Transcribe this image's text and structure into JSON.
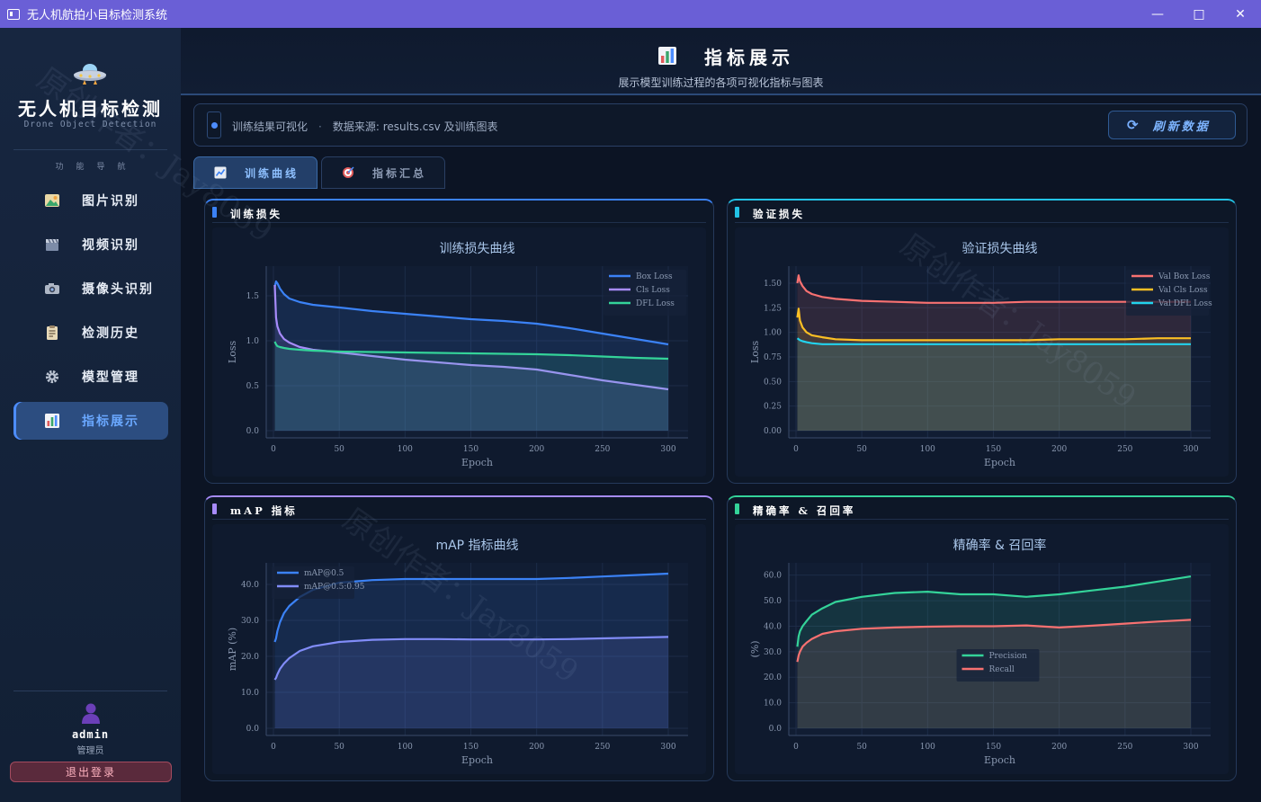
{
  "window": {
    "title": "无人机航拍小目标检测系统",
    "controls": [
      "minimize-icon",
      "maximize-icon",
      "close-icon"
    ]
  },
  "sidebar": {
    "brand_title": "无人机目标检测",
    "brand_subtitle": "Drone Object Detection",
    "nav_header": "功能导航",
    "items": [
      {
        "label": "图片识别",
        "icon": "image-icon"
      },
      {
        "label": "视频识别",
        "icon": "clapperboard-icon"
      },
      {
        "label": "摄像头识别",
        "icon": "camera-icon"
      },
      {
        "label": "检测历史",
        "icon": "clipboard-icon"
      },
      {
        "label": "模型管理",
        "icon": "gear-icon"
      },
      {
        "label": "指标展示",
        "icon": "bar-chart-icon",
        "active": true
      }
    ],
    "user": {
      "name": "admin",
      "role": "管理员"
    },
    "logout_label": "退出登录"
  },
  "header": {
    "title": "指标展示",
    "subtitle": "展示模型训练过程的各项可视化指标与图表"
  },
  "info_bar": {
    "label": "训练结果可视化",
    "separator": "·",
    "source": "数据来源: results.csv 及训练图表"
  },
  "refresh_label": "刷新数据",
  "tabs": [
    {
      "label": "训练曲线",
      "active": true
    },
    {
      "label": "指标汇总",
      "active": false
    }
  ],
  "panels": [
    {
      "title": "训练损失",
      "accent": "#3b82f6"
    },
    {
      "title": "验证损失",
      "accent": "#22c3e6"
    },
    {
      "title": "mAP 指标",
      "accent": "#a78bfa"
    },
    {
      "title": "精确率 & 召回率",
      "accent": "#34d399"
    }
  ],
  "watermark": "原创作者：Jay8059",
  "colors": {
    "titlebar": "#6a5fd6",
    "accent": "#4d8dff",
    "panel_bg": "#0f1a2e"
  },
  "chart_data": [
    {
      "type": "line",
      "title": "训练损失曲线",
      "xlabel": "Epoch",
      "ylabel": "Loss",
      "xlim": [
        0,
        300
      ],
      "ylim": [
        0,
        1.75
      ],
      "xticks": [
        0,
        50,
        100,
        150,
        200,
        250,
        300
      ],
      "yticks": [
        0,
        0.5,
        1.0,
        1.5
      ],
      "ytick_labels": [
        "0.0",
        "0.5",
        "1.0",
        "1.5"
      ],
      "legend": "top-right",
      "grid": true,
      "x": [
        1,
        2,
        3,
        5,
        8,
        12,
        20,
        30,
        50,
        75,
        100,
        125,
        150,
        175,
        200,
        225,
        250,
        275,
        300
      ],
      "series": [
        {
          "name": "Box Loss",
          "color": "#3b82f6",
          "values": [
            1.6,
            1.66,
            1.64,
            1.58,
            1.52,
            1.47,
            1.43,
            1.4,
            1.37,
            1.33,
            1.3,
            1.27,
            1.24,
            1.22,
            1.19,
            1.14,
            1.08,
            1.02,
            0.96
          ]
        },
        {
          "name": "Cls Loss",
          "color": "#a78bfa",
          "values": [
            1.62,
            1.26,
            1.16,
            1.08,
            1.02,
            0.98,
            0.93,
            0.9,
            0.87,
            0.83,
            0.79,
            0.76,
            0.73,
            0.71,
            0.68,
            0.62,
            0.56,
            0.51,
            0.46
          ]
        },
        {
          "name": "DFL Loss",
          "color": "#34d399",
          "values": [
            0.99,
            0.96,
            0.94,
            0.93,
            0.92,
            0.91,
            0.9,
            0.89,
            0.88,
            0.875,
            0.87,
            0.865,
            0.86,
            0.855,
            0.85,
            0.84,
            0.825,
            0.81,
            0.8
          ]
        }
      ]
    },
    {
      "type": "line",
      "title": "验证损失曲线",
      "xlabel": "Epoch",
      "ylabel": "Loss",
      "xlim": [
        0,
        300
      ],
      "ylim": [
        0,
        1.6
      ],
      "xticks": [
        0,
        50,
        100,
        150,
        200,
        250,
        300
      ],
      "yticks": [
        0,
        0.25,
        0.5,
        0.75,
        1.0,
        1.25,
        1.5
      ],
      "ytick_labels": [
        "0.00",
        "0.25",
        "0.50",
        "0.75",
        "1.00",
        "1.25",
        "1.50"
      ],
      "legend": "top-right",
      "grid": true,
      "x": [
        1,
        2,
        3,
        5,
        8,
        12,
        20,
        30,
        50,
        75,
        100,
        125,
        150,
        175,
        200,
        225,
        250,
        275,
        300
      ],
      "series": [
        {
          "name": "Val Box Loss",
          "color": "#f87171",
          "values": [
            1.5,
            1.58,
            1.52,
            1.47,
            1.42,
            1.39,
            1.36,
            1.34,
            1.32,
            1.31,
            1.3,
            1.3,
            1.3,
            1.31,
            1.31,
            1.31,
            1.31,
            1.31,
            1.31
          ]
        },
        {
          "name": "Val Cls Loss",
          "color": "#fbbf24",
          "values": [
            1.15,
            1.24,
            1.12,
            1.05,
            1.0,
            0.97,
            0.95,
            0.93,
            0.92,
            0.92,
            0.92,
            0.92,
            0.92,
            0.92,
            0.93,
            0.93,
            0.93,
            0.94,
            0.94
          ]
        },
        {
          "name": "Val DFL Loss",
          "color": "#22d3ee",
          "values": [
            0.94,
            0.93,
            0.92,
            0.91,
            0.9,
            0.89,
            0.88,
            0.88,
            0.88,
            0.88,
            0.88,
            0.88,
            0.88,
            0.88,
            0.88,
            0.88,
            0.88,
            0.88,
            0.88
          ]
        }
      ]
    },
    {
      "type": "line",
      "title": "mAP 指标曲线",
      "xlabel": "Epoch",
      "ylabel": "mAP (%)",
      "xlim": [
        0,
        300
      ],
      "ylim": [
        0,
        44
      ],
      "xticks": [
        0,
        50,
        100,
        150,
        200,
        250,
        300
      ],
      "yticks": [
        0,
        10,
        20,
        30,
        40
      ],
      "ytick_labels": [
        "0.0",
        "10.0",
        "20.0",
        "30.0",
        "40.0"
      ],
      "legend": "top-left",
      "grid": true,
      "x": [
        1,
        2,
        3,
        5,
        8,
        12,
        20,
        30,
        50,
        75,
        100,
        125,
        150,
        175,
        200,
        225,
        250,
        275,
        300
      ],
      "series": [
        {
          "name": "mAP@0.5",
          "color": "#3b82f6",
          "values": [
            24,
            25,
            27,
            29.5,
            32,
            34,
            36.5,
            38.5,
            40.5,
            41.2,
            41.5,
            41.5,
            41.5,
            41.5,
            41.5,
            41.8,
            42.2,
            42.6,
            43
          ]
        },
        {
          "name": "mAP@0.5:0.95",
          "color": "#818cf8",
          "values": [
            13.5,
            14,
            15,
            16.5,
            18,
            19.5,
            21.5,
            22.8,
            24,
            24.6,
            24.8,
            24.8,
            24.7,
            24.7,
            24.7,
            24.8,
            25,
            25.2,
            25.4
          ]
        }
      ]
    },
    {
      "type": "line",
      "title": "精确率 & 召回率",
      "xlabel": "Epoch",
      "ylabel": "(%)",
      "xlim": [
        0,
        300
      ],
      "ylim": [
        0,
        62
      ],
      "xticks": [
        0,
        50,
        100,
        150,
        200,
        250,
        300
      ],
      "yticks": [
        0,
        10,
        20,
        30,
        40,
        50,
        60
      ],
      "ytick_labels": [
        "0.0",
        "10.0",
        "20.0",
        "30.0",
        "40.0",
        "50.0",
        "60.0"
      ],
      "legend": "center",
      "grid": true,
      "x": [
        1,
        2,
        3,
        5,
        8,
        12,
        20,
        30,
        50,
        75,
        100,
        125,
        150,
        175,
        200,
        225,
        250,
        275,
        300
      ],
      "series": [
        {
          "name": "Precision",
          "color": "#34d399",
          "values": [
            32,
            36,
            38,
            40,
            42,
            44.5,
            47,
            49.5,
            51.5,
            53,
            53.5,
            52.5,
            52.5,
            51.5,
            52.5,
            54,
            55.5,
            57.5,
            59.5
          ]
        },
        {
          "name": "Recall",
          "color": "#f87171",
          "values": [
            26,
            28.5,
            30,
            32,
            33.5,
            35,
            37,
            38,
            39,
            39.5,
            39.8,
            40,
            40,
            40.3,
            39.5,
            40.2,
            41,
            41.8,
            42.5
          ]
        }
      ]
    }
  ]
}
